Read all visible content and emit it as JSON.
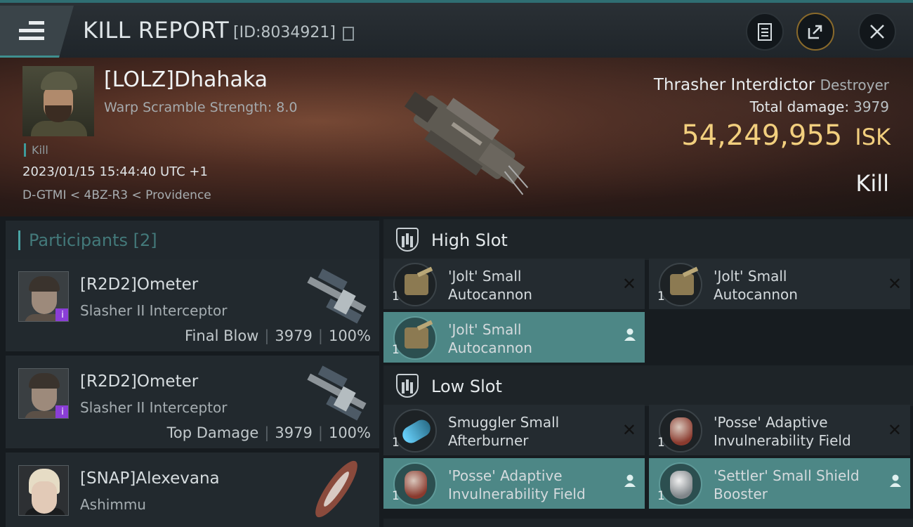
{
  "header": {
    "title": "KILL REPORT",
    "report_id": "[ID:8034921]",
    "icons": [
      "menu-icon",
      "copy-icon",
      "clipboard-icon",
      "share-icon",
      "close-icon"
    ]
  },
  "victim": {
    "name": "[LOLZ]Dhahaka",
    "subtitle": "Warp Scramble Strength: 8.0",
    "tag": "Kill",
    "timestamp": "2023/01/15 15:44:40 UTC +1",
    "location": "D-GTMI < 4BZ-R3 < Providence",
    "ship": "Thrasher Interdictor",
    "ship_class": "Destroyer",
    "damage_label": "Total damage:",
    "damage_value": "3979",
    "isk_value": "54,249,955",
    "isk_unit": "ISK",
    "outcome": "Kill"
  },
  "participants": {
    "title": "Participants",
    "count": "[2]",
    "rows": [
      {
        "name": "[R2D2]Ometer",
        "ship": "Slasher II Interceptor",
        "role": "Final Blow",
        "damage": "3979",
        "percent": "100%",
        "badge": "i"
      },
      {
        "name": "[R2D2]Ometer",
        "ship": "Slasher II Interceptor",
        "role": "Top Damage",
        "damage": "3979",
        "percent": "100%",
        "badge": "i"
      },
      {
        "name": "[SNAP]Alexevana",
        "ship": "Ashimmu"
      }
    ]
  },
  "fitting": {
    "high_slot": {
      "title": "High Slot",
      "items": [
        {
          "line1": "'Jolt' Small",
          "line2": "Autocannon",
          "qty": "1",
          "status": "destroyed"
        },
        {
          "line1": "'Jolt' Small",
          "line2": "Autocannon",
          "qty": "1",
          "status": "destroyed"
        },
        {
          "line1": "'Jolt' Small",
          "line2": "Autocannon",
          "qty": "1",
          "status": "dropped"
        }
      ]
    },
    "low_slot": {
      "title": "Low Slot",
      "items": [
        {
          "line1": "Smuggler Small",
          "line2": "Afterburner",
          "qty": "1",
          "status": "destroyed"
        },
        {
          "line1": "'Posse' Adaptive",
          "line2": "Invulnerability Field",
          "qty": "1",
          "status": "destroyed"
        },
        {
          "line1": "'Posse' Adaptive",
          "line2": "Invulnerability Field",
          "qty": "1",
          "status": "dropped"
        },
        {
          "line1": "'Settler' Small Shield",
          "line2": "Booster",
          "qty": "1",
          "status": "dropped"
        }
      ]
    }
  },
  "colors": {
    "accent_teal": "#4d8786",
    "isk_gold": "#f2cf7e",
    "badge_purple": "#8a3ed6"
  }
}
